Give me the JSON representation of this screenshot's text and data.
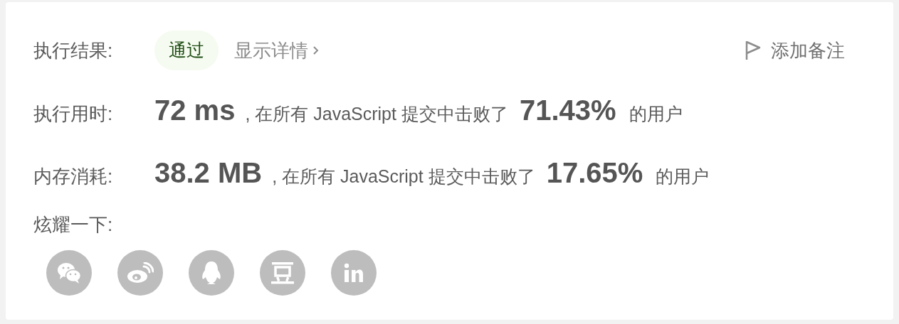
{
  "result": {
    "label": "执行结果:",
    "status": "通过",
    "details_link": "显示详情",
    "note_button": "添加备注"
  },
  "stats": [
    {
      "label": "执行用时:",
      "value": "72 ms",
      "text": ", 在所有 JavaScript 提交中击败了",
      "percent": "71.43%",
      "suffix": "的用户"
    },
    {
      "label": "内存消耗:",
      "value": "38.2 MB",
      "text": ", 在所有 JavaScript 提交中击败了",
      "percent": "17.65%",
      "suffix": "的用户"
    }
  ],
  "share": {
    "label": "炫耀一下:",
    "buttons": [
      {
        "kind": "wechat"
      },
      {
        "kind": "weibo"
      },
      {
        "kind": "qq"
      },
      {
        "kind": "douban"
      },
      {
        "kind": "linkedin"
      }
    ]
  }
}
